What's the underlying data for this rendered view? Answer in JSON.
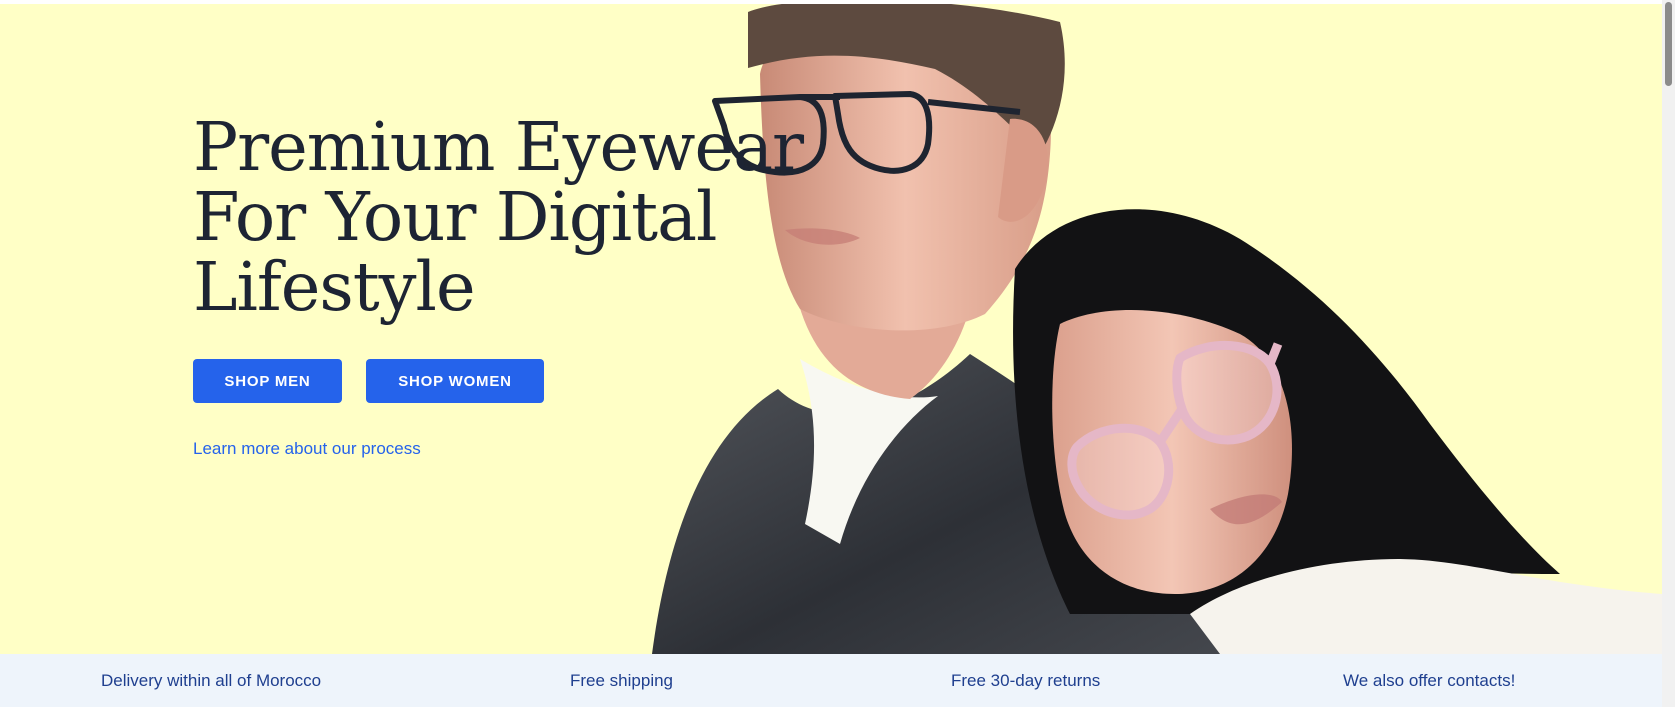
{
  "hero": {
    "title_lines": [
      "Premium Eyewear",
      "For Your Digital",
      "Lifestyle"
    ],
    "buttons": {
      "men": "SHOP MEN",
      "women": "SHOP WOMEN"
    },
    "learn_more": "Learn more about our process",
    "background_color": "#ffffc6",
    "button_color": "#2563eb",
    "image_subject": "couple-wearing-glasses-photo"
  },
  "benefits": [
    "Delivery within all of Morocco",
    "Free shipping",
    "Free 30-day returns",
    "We also offer contacts!"
  ],
  "colors": {
    "title_text": "#1d2433",
    "benefit_text": "#1f3f8f",
    "benefit_background": "#eef4fb"
  }
}
